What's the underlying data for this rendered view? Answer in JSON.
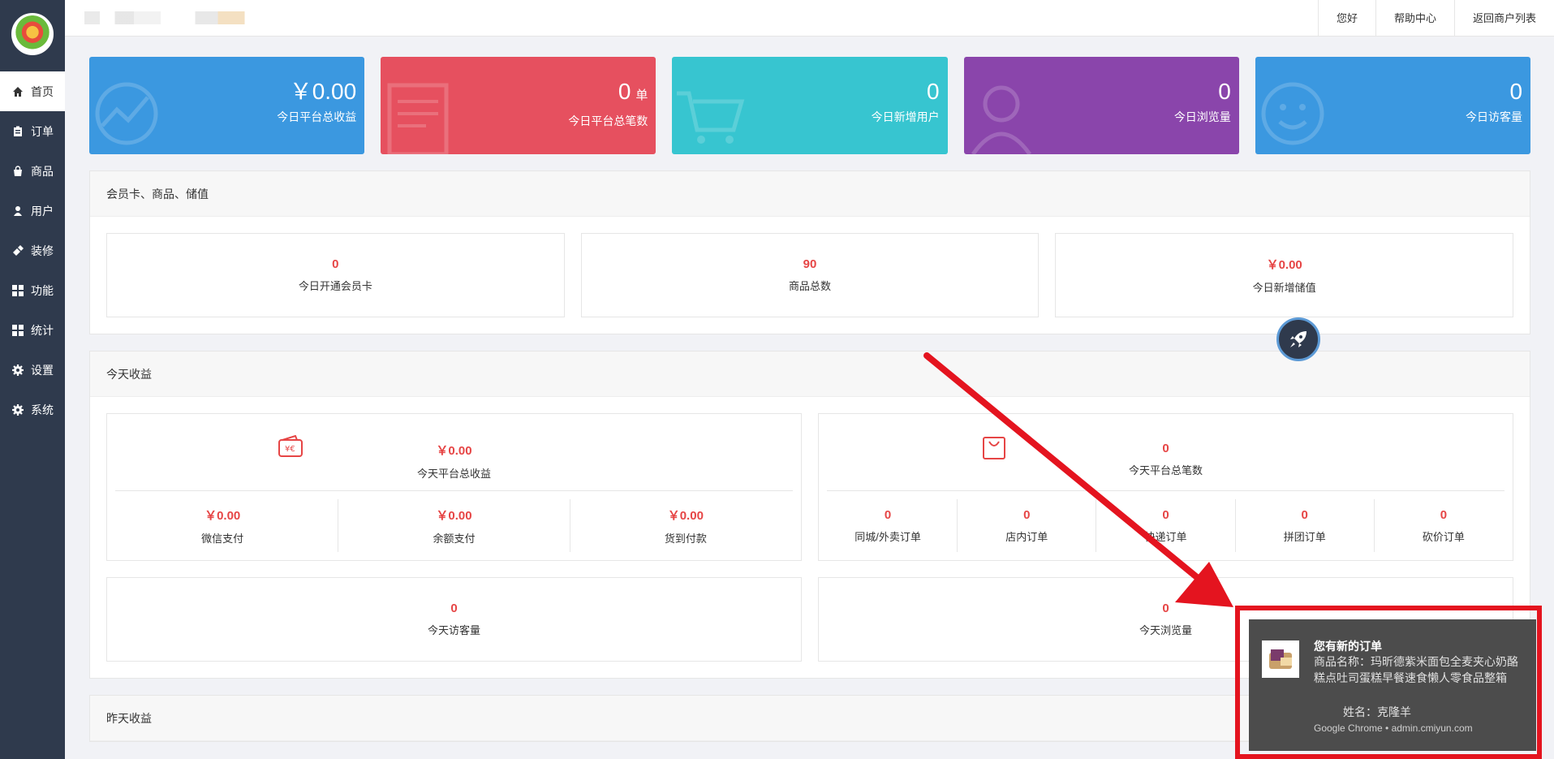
{
  "sidebar": {
    "items": [
      {
        "label": "首页",
        "icon": "home-icon",
        "active": true
      },
      {
        "label": "订单",
        "icon": "clipboard-icon"
      },
      {
        "label": "商品",
        "icon": "shopping-bag-icon"
      },
      {
        "label": "用户",
        "icon": "user-icon"
      },
      {
        "label": "装修",
        "icon": "brush-icon"
      },
      {
        "label": "功能",
        "icon": "grid-icon"
      },
      {
        "label": "统计",
        "icon": "grid-icon"
      },
      {
        "label": "设置",
        "icon": "gear-icon"
      },
      {
        "label": "系统",
        "icon": "gear-icon"
      }
    ]
  },
  "topbar": {
    "links": [
      "您好",
      "帮助中心",
      "返回商户列表"
    ]
  },
  "stats": [
    {
      "value": "￥0.00",
      "unit": "",
      "label": "今日平台总收益",
      "color": "#3b98e0"
    },
    {
      "value": "0",
      "unit": "单",
      "label": "今日平台总笔数",
      "color": "#e6505f"
    },
    {
      "value": "0",
      "unit": "",
      "label": "今日新增用户",
      "color": "#37c5d0"
    },
    {
      "value": "0",
      "unit": "",
      "label": "今日浏览量",
      "color": "#8a45ab"
    },
    {
      "value": "0",
      "unit": "",
      "label": "今日访客量",
      "color": "#3b98e0"
    }
  ],
  "member_panel": {
    "title": "会员卡、商品、储值",
    "boxes": [
      {
        "value": "0",
        "label": "今日开通会员卡"
      },
      {
        "value": "90",
        "label": "商品总数"
      },
      {
        "value": "￥0.00",
        "label": "今日新增储值"
      }
    ]
  },
  "today_panel": {
    "title": "今天收益",
    "income": {
      "value": "￥0.00",
      "label": "今天平台总收益",
      "items": [
        {
          "value": "￥0.00",
          "label": "微信支付"
        },
        {
          "value": "￥0.00",
          "label": "余额支付"
        },
        {
          "value": "￥0.00",
          "label": "货到付款"
        }
      ]
    },
    "orders": {
      "value": "0",
      "label": "今天平台总笔数",
      "items": [
        {
          "value": "0",
          "label": "同城/外卖订单"
        },
        {
          "value": "0",
          "label": "店内订单"
        },
        {
          "value": "0",
          "label": "快递订单"
        },
        {
          "value": "0",
          "label": "拼团订单"
        },
        {
          "value": "0",
          "label": "砍价订单"
        }
      ]
    },
    "visitors": {
      "value": "0",
      "label": "今天访客量"
    },
    "views": {
      "value": "0",
      "label": "今天浏览量"
    }
  },
  "yesterday_panel": {
    "title": "昨天收益"
  },
  "notification": {
    "title": "您有新的订单",
    "body": "商品名称：玛昕德紫米面包全麦夹心奶酪糕点吐司蛋糕早餐速食懒人零食品整箱",
    "name": "姓名：克隆羊",
    "source": "Google Chrome • admin.cmiyun.com"
  },
  "colors": {
    "sidebar": "#2f3a4d",
    "accent_red": "#e64545",
    "highlight": "#e4141f"
  }
}
